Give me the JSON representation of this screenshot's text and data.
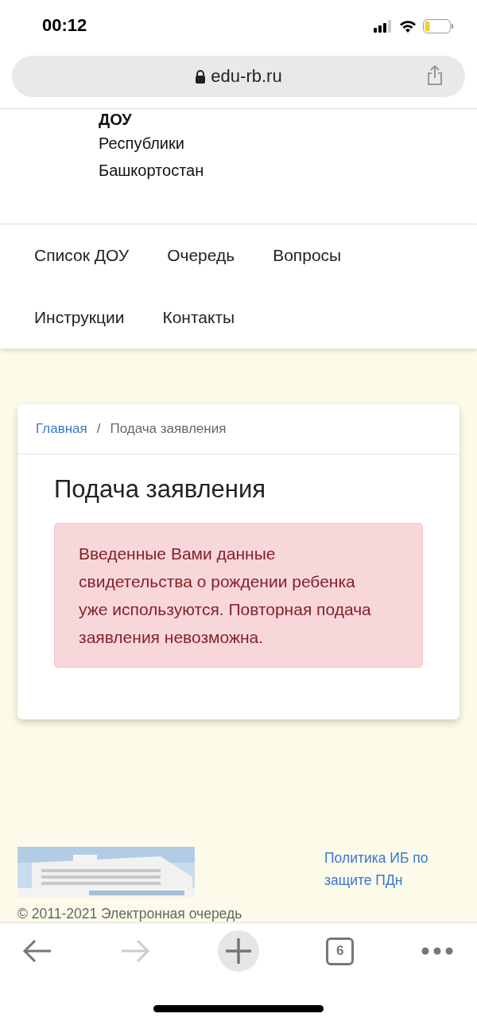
{
  "status_bar": {
    "time": "00:12"
  },
  "address_bar": {
    "url": "edu-rb.ru"
  },
  "header": {
    "title_lines": [
      "ДОУ",
      "Республики",
      "Башкортостан"
    ]
  },
  "nav": {
    "rows": [
      [
        "Список ДОУ",
        "Очередь",
        "Вопросы"
      ],
      [
        "Инструкции",
        "Контакты"
      ]
    ]
  },
  "breadcrumb": [
    {
      "label": "Главная",
      "link": true
    },
    {
      "separator": "/",
      "label": "Подача заявления",
      "link": false
    }
  ],
  "page_title": "Подача заявления",
  "alert": {
    "kind": "danger",
    "text": "Введенные Вами данные свидетельства о рождении ребенка уже используются. Повторная подача заявления невозможна."
  },
  "footer": {
    "link": "Политика ИБ по защите ПДн",
    "copyright": "© 2011-2021 Электронная очередь"
  },
  "toolbar": {
    "back_disabled": false,
    "forward_disabled": true,
    "tabs_count": "6"
  }
}
